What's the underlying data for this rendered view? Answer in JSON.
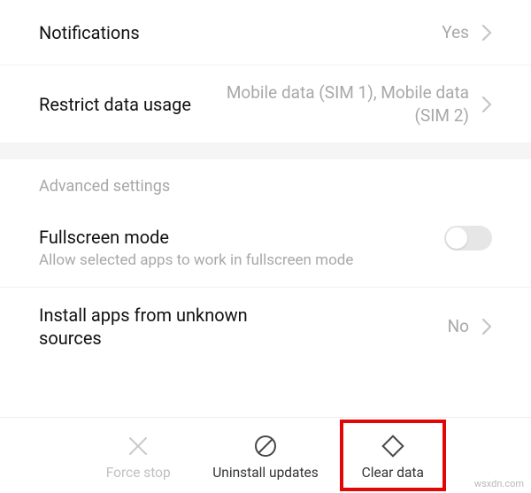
{
  "rows": {
    "notifications": {
      "title": "Notifications",
      "value": "Yes"
    },
    "restrict": {
      "title": "Restrict data usage",
      "value": "Mobile data (SIM 1), Mobile data (SIM 2)"
    },
    "fullscreen": {
      "title": "Fullscreen mode",
      "subtitle": "Allow selected apps to work in fullscreen mode"
    },
    "unknown": {
      "title": "Install apps from unknown sources",
      "value": "No"
    }
  },
  "section_header": "Advanced settings",
  "actions": {
    "force_stop": "Force stop",
    "uninstall": "Uninstall updates",
    "clear_data": "Clear data"
  },
  "watermark": "wsxdn.com"
}
